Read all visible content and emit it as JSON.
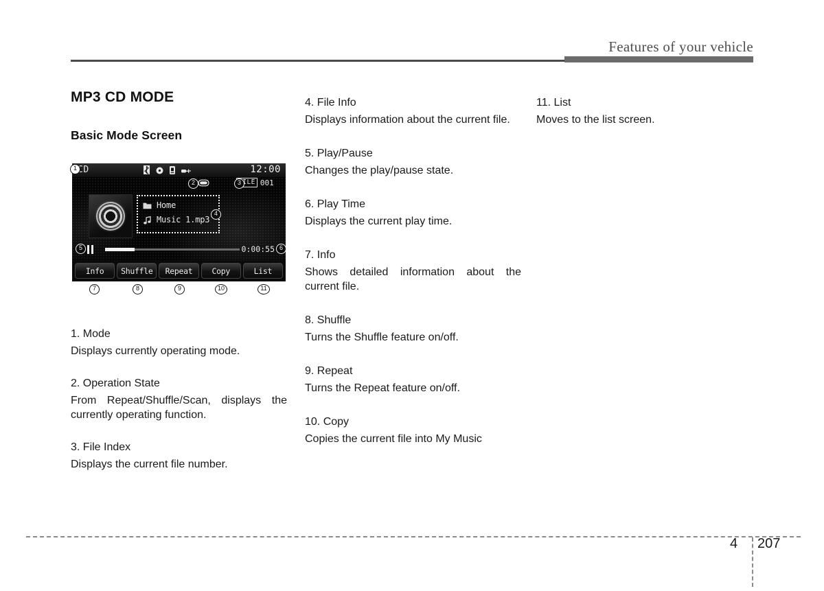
{
  "header": {
    "title": "Features of your vehicle"
  },
  "footer": {
    "chapter": "4",
    "page": "207"
  },
  "column1": {
    "section_title": "MP3 CD MODE",
    "subsection_title": "Basic Mode Screen",
    "entries": [
      {
        "title": "1. Mode",
        "body": "Displays currently operating mode."
      },
      {
        "title": "2. Operation State",
        "body": "From Repeat/Shuffle/Scan, displays the currently operating function."
      },
      {
        "title": "3. File Index",
        "body": "Displays the current file number."
      }
    ]
  },
  "column2": {
    "entries": [
      {
        "title": "4. File Info",
        "body": "Displays information about the current file."
      },
      {
        "title": "5. Play/Pause",
        "body": "Changes the play/pause state."
      },
      {
        "title": "6. Play Time",
        "body": "Displays the current play time."
      },
      {
        "title": "7. Info",
        "body": "Shows detailed information about the current file."
      },
      {
        "title": "8. Shuffle",
        "body": "Turns the Shuffle feature on/off."
      },
      {
        "title": "9. Repeat",
        "body": "Turns the Repeat feature on/off."
      },
      {
        "title": "10. Copy",
        "body": "Copies the current file into My Music"
      }
    ]
  },
  "column3": {
    "entries": [
      {
        "title": "11. List",
        "body": "Moves to the list screen."
      }
    ]
  },
  "device_screen": {
    "mode_label": "CD",
    "clock": "12:00",
    "status_icons": [
      "bluetooth-icon",
      "disc-icon",
      "sim-card-icon",
      "usb-plug-icon"
    ],
    "operation_state": {
      "icon": "repeat-one-icon",
      "value": "1"
    },
    "file_index": {
      "tag": "FILE",
      "value": "001"
    },
    "album_art_icon": "cd-disc-icon",
    "file_info": {
      "folder_icon": "folder-icon",
      "folder_name": "Home",
      "track_icon": "music-note-icon",
      "track_name": "Music 1.mp3"
    },
    "playback": {
      "state_icon": "pause-icon",
      "progress_percent": 22,
      "play_time": "0:00:55"
    },
    "buttons": [
      {
        "label": "Info"
      },
      {
        "label": "Shuffle"
      },
      {
        "label": "Repeat"
      },
      {
        "label": "Copy"
      },
      {
        "label": "List"
      }
    ],
    "callouts": [
      "1",
      "2",
      "3",
      "4",
      "5",
      "6",
      "7",
      "8",
      "9",
      "10",
      "11"
    ]
  }
}
